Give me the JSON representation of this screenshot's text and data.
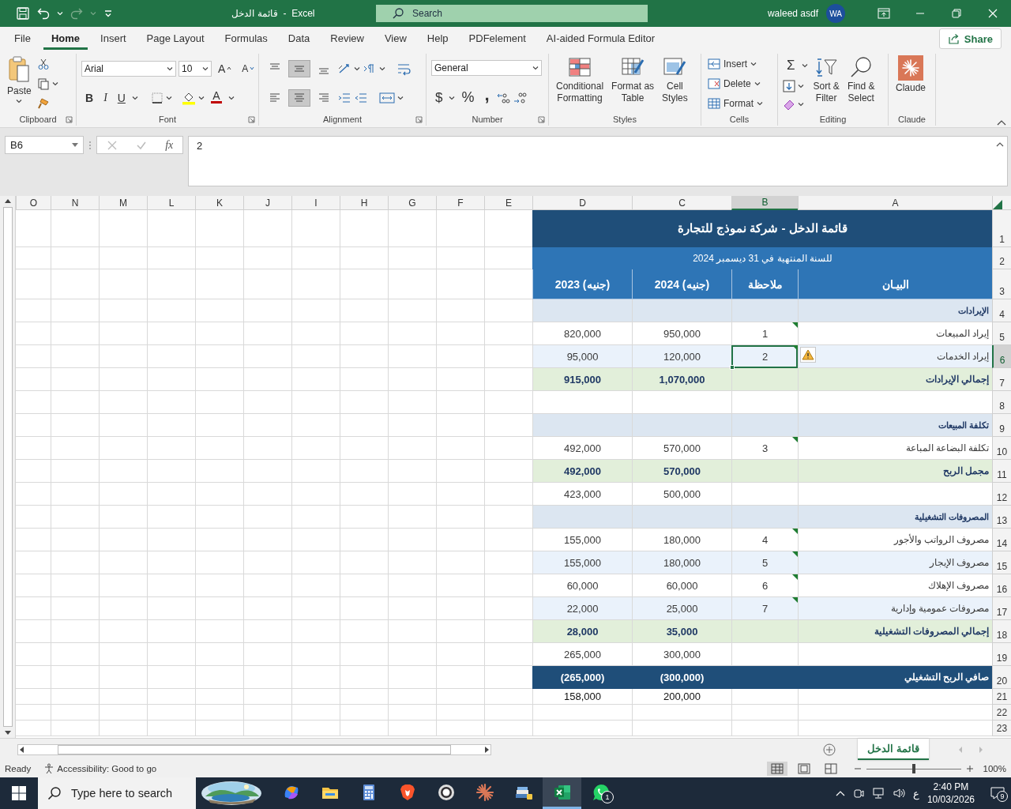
{
  "title_bar": {
    "title": "قائمة الدخل  -  Excel",
    "search": {
      "placeholder": "Search"
    },
    "user": "waleed asdf",
    "avatar": "WA"
  },
  "menu_tabs": [
    {
      "label": "File",
      "selected": false
    },
    {
      "label": "Home",
      "selected": true
    },
    {
      "label": "Insert",
      "selected": false
    },
    {
      "label": "Page Layout",
      "selected": false
    },
    {
      "label": "Formulas",
      "selected": false
    },
    {
      "label": "Data",
      "selected": false
    },
    {
      "label": "Review",
      "selected": false
    },
    {
      "label": "View",
      "selected": false
    },
    {
      "label": "Help",
      "selected": false
    },
    {
      "label": "PDFelement",
      "selected": false
    },
    {
      "label": "AI-aided Formula Editor",
      "selected": false
    }
  ],
  "share": "Share",
  "ribbon": {
    "clipboard": {
      "paste": "Paste",
      "label": "Clipboard"
    },
    "font": {
      "font_name": "Arial",
      "font_size": "10",
      "grow": "A",
      "shrink": "A",
      "bold": "B",
      "italic": "I",
      "underline": "U",
      "font_color": "A",
      "label": "Font"
    },
    "alignment": {
      "vertical": [
        {
          "selected": false
        },
        {
          "selected": true
        },
        {
          "selected": false
        }
      ],
      "horizontal": [
        {
          "selected": false
        },
        {
          "selected": true
        },
        {
          "selected": false
        }
      ],
      "label": "Alignment"
    },
    "number": {
      "format": "General",
      "currency": "$",
      "percent": "%",
      "comma": ",",
      "label": "Number"
    },
    "styles": {
      "conditional": "Conditional\nFormatting",
      "table": "Format as\nTable",
      "cell_styles": "Cell\nStyles",
      "label": "Styles"
    },
    "cells": {
      "insert": "Insert",
      "delete": "Delete",
      "format": "Format",
      "label": "Cells"
    },
    "editing": {
      "autosum": "Σ",
      "sort": "Sort &\nFilter",
      "find": "Find &\nSelect",
      "label": "Editing"
    },
    "claude": {
      "button": "Claude",
      "label": "Claude"
    }
  },
  "formula_bar": {
    "name_box": "B6",
    "fx": "fx",
    "value": "2"
  },
  "sheet": {
    "columns": [
      {
        "label": "O",
        "selected": false
      },
      {
        "label": "N",
        "selected": false
      },
      {
        "label": "M",
        "selected": false
      },
      {
        "label": "L",
        "selected": false
      },
      {
        "label": "K",
        "selected": false
      },
      {
        "label": "J",
        "selected": false
      },
      {
        "label": "I",
        "selected": false
      },
      {
        "label": "H",
        "selected": false
      },
      {
        "label": "G",
        "selected": false
      },
      {
        "label": "F",
        "selected": false
      },
      {
        "label": "E",
        "selected": false
      },
      {
        "label": "D",
        "selected": false
      },
      {
        "label": "C",
        "selected": false
      },
      {
        "label": "B",
        "selected": true
      },
      {
        "label": "A",
        "selected": false
      }
    ],
    "rows": [
      {
        "row": "1",
        "kind": "title",
        "selected": false,
        "text": "قائمة الدخل - شركة نموذج للتجارة"
      },
      {
        "row": "2",
        "kind": "subtitle",
        "selected": false,
        "text": "للسنة المنتهية في 31 ديسمبر 2024"
      },
      {
        "row": "3",
        "kind": "header",
        "selected": false,
        "label": "البيـان",
        "note": "ملاحظة",
        "y2024": "(جنيه) 2024",
        "y2023": "(جنيه) 2023"
      },
      {
        "row": "4",
        "kind": "section",
        "selected": false,
        "label": "الإيرادات"
      },
      {
        "row": "5",
        "kind": "item",
        "selected": false,
        "banded": false,
        "flagged": true,
        "warning": false,
        "label": "إيراد المبيعات",
        "note": "1",
        "y2024": "950,000",
        "y2023": "820,000"
      },
      {
        "row": "6",
        "kind": "item",
        "selected": true,
        "banded": true,
        "flagged": true,
        "warning": true,
        "label": "إيراد الخدمات",
        "note": "2",
        "y2024": "120,000",
        "y2023": "95,000"
      },
      {
        "row": "7",
        "kind": "total",
        "selected": false,
        "label": "إجمالي الإيرادات",
        "y2024": "1,070,000",
        "y2023": "915,000"
      },
      {
        "row": "8",
        "kind": "blank",
        "selected": false
      },
      {
        "row": "9",
        "kind": "section",
        "selected": false,
        "label": "تكلفة المبيعات"
      },
      {
        "row": "10",
        "kind": "item",
        "selected": false,
        "banded": false,
        "flagged": true,
        "warning": false,
        "label": "تكلفة البضاعة المباعة",
        "note": "3",
        "y2024": "570,000",
        "y2023": "492,000"
      },
      {
        "row": "11",
        "kind": "total",
        "selected": false,
        "label": "مجمل الربح",
        "y2024": "570,000",
        "y2023": "492,000"
      },
      {
        "row": "12",
        "kind": "item",
        "selected": false,
        "banded": false,
        "flagged": false,
        "warning": false,
        "y2024": "500,000",
        "y2023": "423,000"
      },
      {
        "row": "13",
        "kind": "section",
        "selected": false,
        "label": "المصروفات التشغيلية"
      },
      {
        "row": "14",
        "kind": "item",
        "selected": false,
        "banded": false,
        "flagged": true,
        "warning": false,
        "label": "مصروف الرواتب والأجور",
        "note": "4",
        "y2024": "180,000",
        "y2023": "155,000"
      },
      {
        "row": "15",
        "kind": "item",
        "selected": false,
        "banded": true,
        "flagged": true,
        "warning": false,
        "label": "مصروف الإيجار",
        "note": "5",
        "y2024": "180,000",
        "y2023": "155,000"
      },
      {
        "row": "16",
        "kind": "item",
        "selected": false,
        "banded": false,
        "flagged": true,
        "warning": false,
        "label": "مصروف الإهلاك",
        "note": "6",
        "y2024": "60,000",
        "y2023": "60,000"
      },
      {
        "row": "17",
        "kind": "item",
        "selected": false,
        "banded": true,
        "flagged": true,
        "warning": false,
        "label": "مصروفات عمومية وإدارية",
        "note": "7",
        "y2024": "25,000",
        "y2023": "22,000"
      },
      {
        "row": "18",
        "kind": "total",
        "selected": false,
        "label": "إجمالي المصروفات التشغيلية",
        "y2024": "35,000",
        "y2023": "28,000"
      },
      {
        "row": "19",
        "kind": "item",
        "selected": false,
        "banded": false,
        "flagged": false,
        "warning": false,
        "y2024": "300,000",
        "y2023": "265,000"
      },
      {
        "row": "20",
        "kind": "net",
        "selected": false,
        "label": "صافي الربح التشغيلي",
        "y2024": "(300,000)",
        "y2023": "(265,000)"
      },
      {
        "row": "21",
        "kind": "extra",
        "selected": false,
        "y2024": "200,000",
        "y2023": "158,000"
      },
      {
        "row": "22",
        "kind": "spacer",
        "selected": false
      },
      {
        "row": "23",
        "kind": "spacer",
        "selected": false
      }
    ],
    "tabs": [
      {
        "label": "قائمة الدخل",
        "selected": true
      }
    ]
  },
  "status_bar": {
    "ready": "Ready",
    "accessibility": "Accessibility: Good to go",
    "views": [
      {
        "selected": true
      },
      {
        "selected": false
      },
      {
        "selected": false
      }
    ],
    "zoom": {
      "level": 0.5,
      "text": "100%"
    }
  },
  "taskbar": {
    "search": {
      "placeholder": "Type here to search"
    },
    "apps": [
      {
        "kind": "copilot",
        "selected": false
      },
      {
        "kind": "explorer",
        "selected": false
      },
      {
        "kind": "calculator",
        "selected": false
      },
      {
        "kind": "brave",
        "selected": false
      },
      {
        "kind": "obs",
        "selected": false
      },
      {
        "kind": "claude",
        "selected": false
      },
      {
        "kind": "files",
        "selected": false
      },
      {
        "kind": "excel",
        "selected": true
      },
      {
        "kind": "whatsapp",
        "selected": false,
        "badge": "1"
      }
    ],
    "language": "ع",
    "time": "2:40 PM",
    "date": "10/03/2026",
    "notifications": "9"
  }
}
